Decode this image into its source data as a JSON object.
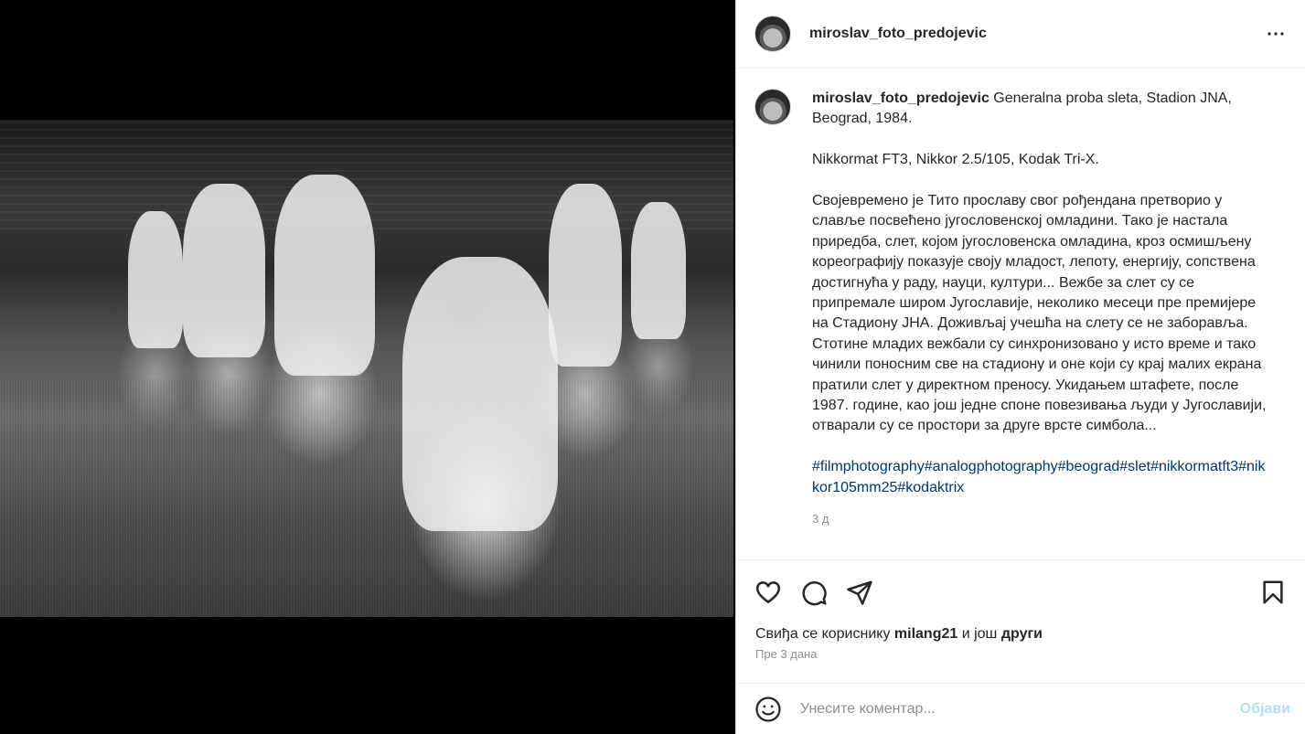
{
  "post": {
    "username": "miroslav_foto_predojevic",
    "more_icon": "more-horizontal-icon",
    "photo_alt": "Generalna proba sleta, Stadion JNA, Beograd, 1984."
  },
  "caption": {
    "username": "miroslav_foto_predojevic",
    "line1": "Generalna proba sleta, Stadion JNA, Beograd, 1984.",
    "line2": "Nikkormat FT3, Nikkor 2.5/105, Kodak Tri-X.",
    "line3": "Својевремено је Тито прославу свог рођендана претворио у славље посвећено југословенској омладини. Тако је настала приредба, слет, којом југословенска омладина, кроз осмишљену кореографију показује своју младост, лепоту, енергију, сопствена достигнућа у раду, науци, култури... Вежбе за слет су се припремале широм Југославије, неколико месеци пре премијере на Стадиону ЈНА. Доживљај учешћа на слету се не заборавља. Стотине младих вежбали су синхронизовано у исто време и тако чинили поносним све на стадиону и оне који су крај малих екрана пратили слет у директном преносу. Укидањем штафете, после 1987. године, као још једне споне повезивања људи у Југославији, отварали су се простори за друге врсте симбола...",
    "hashtags": "#filmphotography#analogphotography#beograd#slet#nikkormatft3#nikkor105mm25#kodaktrix",
    "age": "3 д"
  },
  "actions": {
    "like_icon": "heart-icon",
    "comment_icon": "comment-icon",
    "share_icon": "paper-plane-icon",
    "save_icon": "bookmark-icon"
  },
  "likes": {
    "prefix": "Свиђа се кориснику",
    "user": "milang21",
    "middle": "и још",
    "others": "други"
  },
  "posted": "Пре 3 дана",
  "comment_box": {
    "emoji_icon": "emoji-icon",
    "placeholder": "Унесите коментар...",
    "post_label": "Објави"
  },
  "colors": {
    "link": "#00376b",
    "muted": "#8e8e8e",
    "post_disabled": "#b2dffc"
  }
}
